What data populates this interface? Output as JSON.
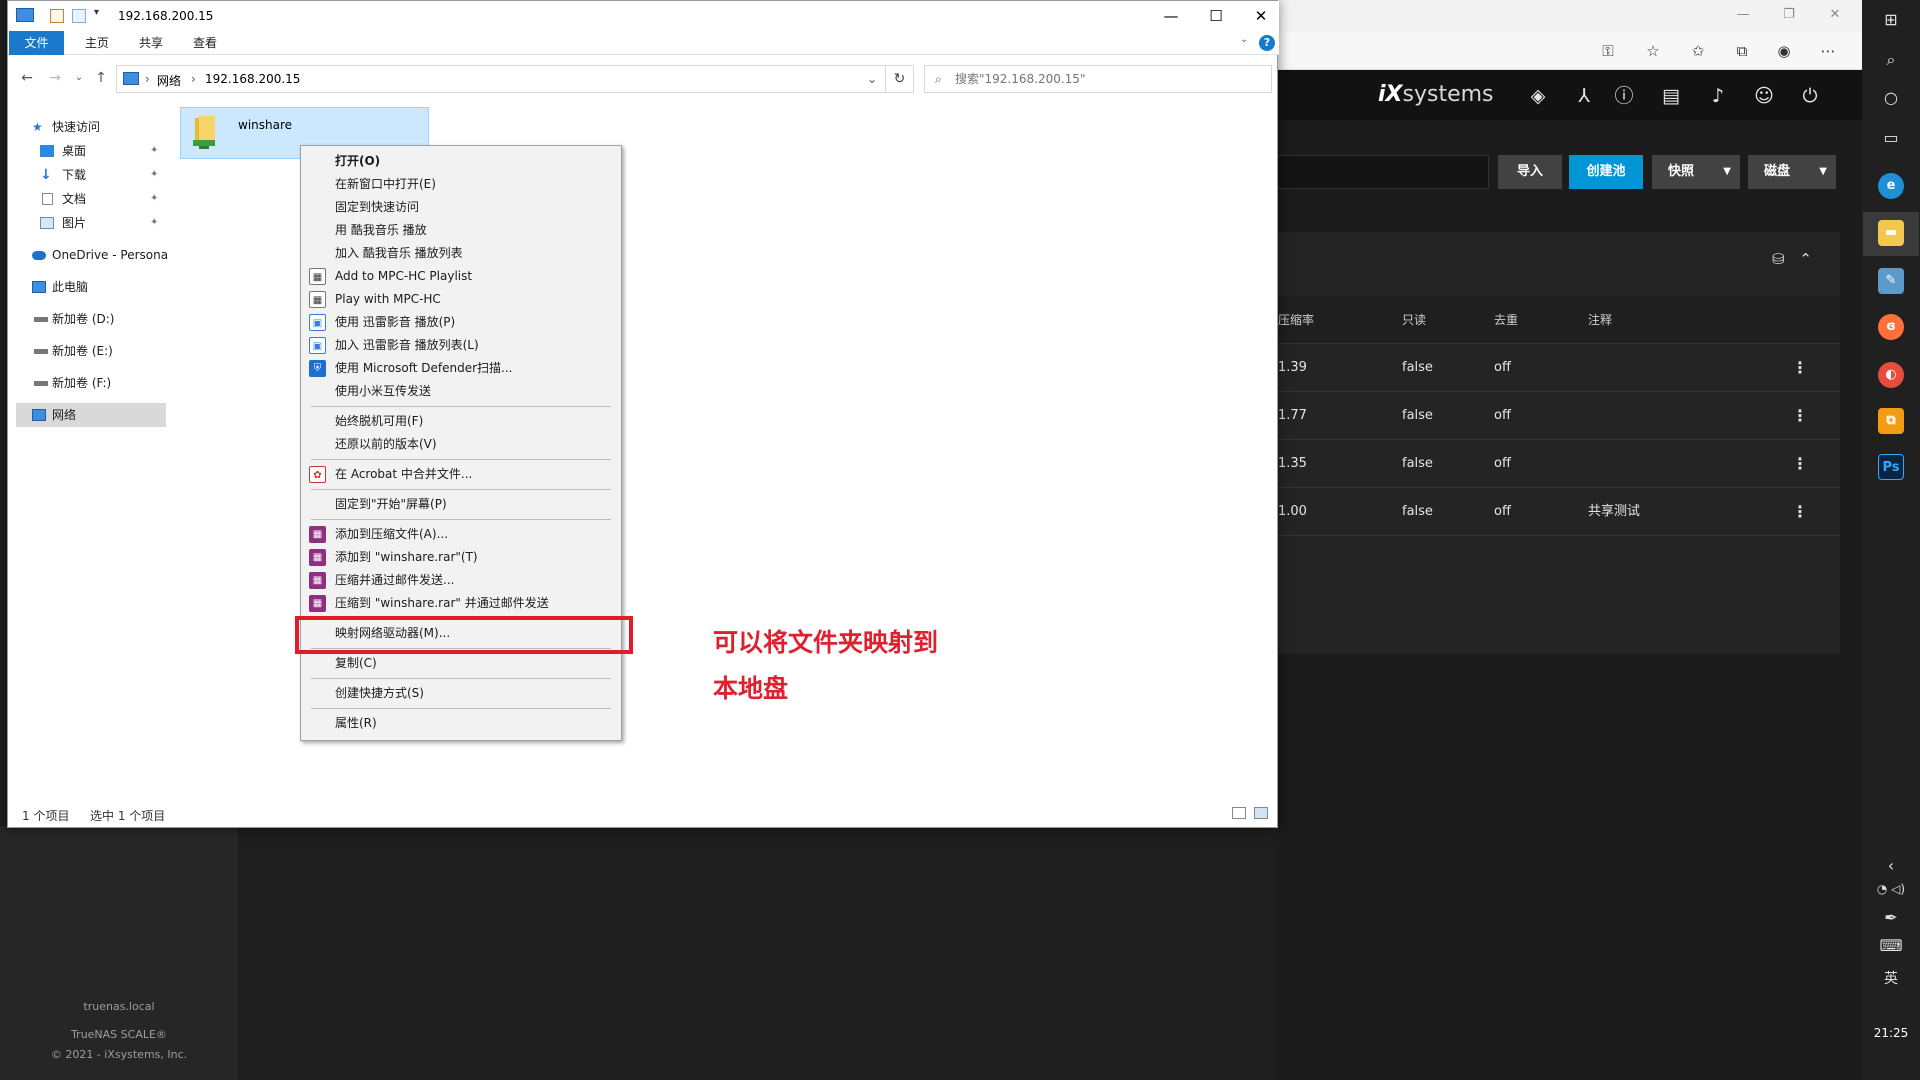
{
  "browser": {
    "header": {
      "logo_main": "iX",
      "logo_rest": "systems"
    },
    "buttons": {
      "import": "导入",
      "create_pool": "创建池",
      "snapshot": "快照",
      "disk": "磁盘"
    },
    "table": {
      "columns": [
        "压缩率",
        "只读",
        "去重",
        "注释"
      ],
      "rows": [
        {
          "ratio": "1.39",
          "readonly": "false",
          "dedup": "off",
          "comment": ""
        },
        {
          "ratio": "1.77",
          "readonly": "false",
          "dedup": "off",
          "comment": ""
        },
        {
          "ratio": "1.35",
          "readonly": "false",
          "dedup": "off",
          "comment": ""
        },
        {
          "ratio": "1.00",
          "readonly": "false",
          "dedup": "off",
          "comment": "共享测试"
        }
      ]
    },
    "footer": {
      "hostname": "truenas.local",
      "product": "TrueNAS SCALE®",
      "copyright": "© 2021 - iXsystems, Inc."
    },
    "accent_color": "#0095d5"
  },
  "taskbar": {
    "ime": "英",
    "clock": "21:25",
    "ps_label": "Ps"
  },
  "explorer": {
    "title": "192.168.200.15",
    "ribbon_tabs": [
      "文件",
      "主页",
      "共享",
      "查看"
    ],
    "ribbon_help": "?",
    "address": {
      "root": "网络",
      "current": "192.168.200.15"
    },
    "search_placeholder": "搜索\"192.168.200.15\"",
    "nav_pane": {
      "quick_access": "快速访问",
      "desktop": "桌面",
      "downloads": "下载",
      "documents": "文档",
      "pictures": "图片",
      "onedrive": "OneDrive - Personal",
      "this_pc": "此电脑",
      "drive_d": "新加卷 (D:)",
      "drive_e": "新加卷 (E:)",
      "drive_f": "新加卷 (F:)",
      "network": "网络"
    },
    "folder": {
      "name": "winshare"
    },
    "status": {
      "count": "1 个项目",
      "selected": "选中 1 个项目"
    }
  },
  "context_menu": {
    "items": {
      "open": "打开(O)",
      "open_new_window": "在新窗口中打开(E)",
      "pin_quick": "固定到快速访问",
      "play_kugou": "用 酷我音乐 播放",
      "add_kugou": "加入 酷我音乐 播放列表",
      "add_mpc": "Add to MPC-HC Playlist",
      "play_mpc": "Play with MPC-HC",
      "play_xunlei": "使用 迅雷影音 播放(P)",
      "add_xunlei": "加入 迅雷影音 播放列表(L)",
      "defender": "使用 Microsoft Defender扫描...",
      "xiaomi": "使用小米互传发送",
      "always_offline": "始终脱机可用(F)",
      "restore_prev": "还原以前的版本(V)",
      "acrobat": "在 Acrobat 中合并文件...",
      "pin_start": "固定到\"开始\"屏幕(P)",
      "add_archive": "添加到压缩文件(A)...",
      "add_rar": "添加到 \"winshare.rar\"(T)",
      "compress_email": "压缩并通过邮件发送...",
      "compress_rar_email": "压缩到 \"winshare.rar\" 并通过邮件发送",
      "map_drive": "映射网络驱动器(M)...",
      "copy": "复制(C)",
      "create_shortcut": "创建快捷方式(S)",
      "properties": "属性(R)"
    }
  },
  "annotation": {
    "line1": "可以将文件夹映射到",
    "line2": "本地盘",
    "color": "#e0202e"
  }
}
